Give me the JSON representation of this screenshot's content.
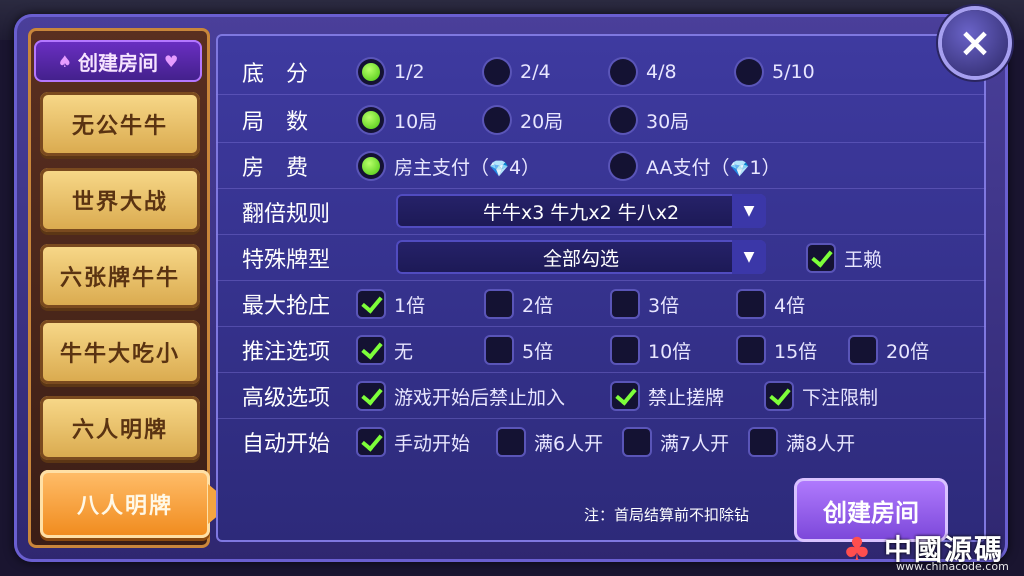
{
  "close_icon": "×",
  "sidebar": {
    "header": "创建房间",
    "header_suit_left": "♠",
    "header_suit_right": "♥",
    "tabs": [
      {
        "label": "无公牛牛"
      },
      {
        "label": "世界大战"
      },
      {
        "label": "六张牌牛牛"
      },
      {
        "label": "牛牛大吃小"
      },
      {
        "label": "六人明牌"
      },
      {
        "label": "八人明牌",
        "active": true
      }
    ]
  },
  "form": {
    "base_score": {
      "label": "底分",
      "options": [
        "1/2",
        "2/4",
        "4/8",
        "5/10"
      ],
      "selected": "1/2"
    },
    "rounds": {
      "label": "局数",
      "options": [
        "10局",
        "20局",
        "30局"
      ],
      "selected": "10局"
    },
    "room_fee": {
      "label": "房费",
      "options": [
        {
          "text": "房主支付（",
          "diamond": "💎",
          "count": "4）"
        },
        {
          "text": "AA支付（",
          "diamond": "💎",
          "count": "1）"
        }
      ],
      "selected": 0
    },
    "double_rule": {
      "label": "翻倍规则",
      "value": "牛牛x3 牛九x2 牛八x2"
    },
    "special_cards": {
      "label": "特殊牌型",
      "value": "全部勾选",
      "extra_label": "王赖",
      "extra_checked": true
    },
    "max_banker": {
      "label": "最大抢庄",
      "options": [
        "1倍",
        "2倍",
        "3倍",
        "4倍"
      ],
      "checked": [
        "1倍"
      ]
    },
    "push_bet": {
      "label": "推注选项",
      "options": [
        "无",
        "5倍",
        "10倍",
        "15倍",
        "20倍"
      ],
      "checked": [
        "无"
      ]
    },
    "advanced": {
      "label": "高级选项",
      "options": [
        "游戏开始后禁止加入",
        "禁止搓牌",
        "下注限制"
      ],
      "checked": [
        "游戏开始后禁止加入",
        "禁止搓牌",
        "下注限制"
      ]
    },
    "auto_start": {
      "label": "自动开始",
      "options": [
        "手动开始",
        "满6人开",
        "满7人开",
        "满8人开"
      ],
      "checked": [
        "手动开始"
      ]
    }
  },
  "note": "注：首局结算前不扣除钻",
  "create_button": "创建房间",
  "watermark": {
    "title": "中國源碼",
    "url": "www.chinacode.com"
  }
}
